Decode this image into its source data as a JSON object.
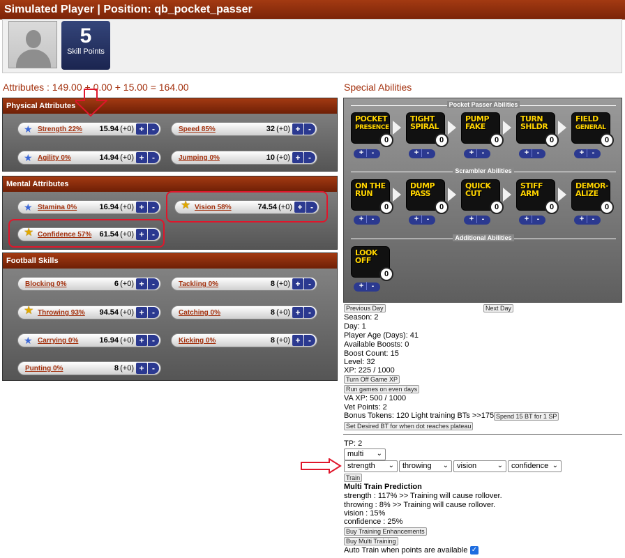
{
  "header": {
    "title": "Simulated Player | Position: qb_pocket_passer"
  },
  "profile": {
    "skill_points": "5",
    "skill_points_label": "Skill Points"
  },
  "attributes_total": "Attributes : 149.00 + 0.00 + 15.00 = 164.00",
  "special_abilities_title": "Special Abilities",
  "physical": {
    "title": "Physical Attributes",
    "strength": {
      "name": "Strength 22%",
      "value": "15.94",
      "bonus": "(+0)"
    },
    "speed": {
      "name": "Speed 85%",
      "value": "32",
      "bonus": "(+0)"
    },
    "agility": {
      "name": "Agility 0%",
      "value": "14.94",
      "bonus": "(+0)"
    },
    "jumping": {
      "name": "Jumping 0%",
      "value": "10",
      "bonus": "(+0)"
    }
  },
  "mental": {
    "title": "Mental Attributes",
    "stamina": {
      "name": "Stamina 0%",
      "value": "16.94",
      "bonus": "(+0)"
    },
    "vision": {
      "name": "Vision 58%",
      "value": "74.54",
      "bonus": "(+0)"
    },
    "confidence": {
      "name": "Confidence 57%",
      "value": "61.54",
      "bonus": "(+0)"
    }
  },
  "football": {
    "title": "Football Skills",
    "blocking": {
      "name": "Blocking 0%",
      "value": "6",
      "bonus": "(+0)"
    },
    "tackling": {
      "name": "Tackling 0%",
      "value": "8",
      "bonus": "(+0)"
    },
    "throwing": {
      "name": "Throwing 93%",
      "value": "94.54",
      "bonus": "(+0)"
    },
    "catching": {
      "name": "Catching 0%",
      "value": "8",
      "bonus": "(+0)"
    },
    "carrying": {
      "name": "Carrying 0%",
      "value": "16.94",
      "bonus": "(+0)"
    },
    "kicking": {
      "name": "Kicking 0%",
      "value": "8",
      "bonus": "(+0)"
    },
    "punting": {
      "name": "Punting 0%",
      "value": "8",
      "bonus": "(+0)"
    }
  },
  "buttons": {
    "plus": "+",
    "minus": "-"
  },
  "abilities": {
    "pocket_title": "Pocket Passer Abilities",
    "scrambler_title": "Scrambler Abilities",
    "additional_title": "Additional Abilities",
    "pocket": [
      {
        "l1": "POCKET",
        "l2": "PRESENCE",
        "level": "0"
      },
      {
        "l1": "TIGHT",
        "l2": "SPIRAL",
        "level": "0"
      },
      {
        "l1": "PUMP",
        "l2": "FAKE",
        "level": "0"
      },
      {
        "l1": "TURN",
        "l2": "SHLDR",
        "level": "0"
      },
      {
        "l1": "FIELD",
        "l2": "GENERAL",
        "level": "0"
      }
    ],
    "scrambler": [
      {
        "l1": "ON THE",
        "l2": "RUN",
        "level": "0"
      },
      {
        "l1": "DUMP",
        "l2": "PASS",
        "level": "0"
      },
      {
        "l1": "QUICK",
        "l2": "CUT",
        "level": "0"
      },
      {
        "l1": "STIFF",
        "l2": "ARM",
        "level": "0"
      },
      {
        "l1": "DEMOR-",
        "l2": "ALIZE",
        "level": "0"
      }
    ],
    "additional": [
      {
        "l1": "LOOK",
        "l2": "OFF",
        "level": "0"
      }
    ]
  },
  "info": {
    "prev_day": "Previous Day",
    "next_day": "Next Day",
    "season": "Season: 2",
    "day": "Day: 1",
    "age": "Player Age (Days): 41",
    "available_boosts": "Available Boosts: 0",
    "boost_count": "Boost Count: 15",
    "level": "Level: 32",
    "xp": "XP: 225 / 1000",
    "turn_off_game_xp": "Turn Off Game XP",
    "run_games": "Run games on even days",
    "va_xp": "VA XP: 500 / 1000",
    "vet_points": "Vet Points: 2",
    "bonus_tokens": "Bonus Tokens: 120 Light training BTs >>1758",
    "spend_bt": "Spend 15 BT for 1 SP",
    "set_desired_bt": "Set Desired BT for when dot reaches plateau"
  },
  "training": {
    "tp": "TP: 2",
    "mode": "multi",
    "selects": [
      "strength",
      "throwing",
      "vision",
      "confidence"
    ],
    "train_button": "Train",
    "prediction_title": "Multi Train Prediction",
    "predictions": [
      "strength : 117% >> Training will cause rollover.",
      "throwing : 8% >> Training will cause rollover.",
      "vision : 15%",
      "confidence : 25%"
    ],
    "buy_enhancements": "Buy Training Enhancements",
    "buy_multi": "Buy Multi Training",
    "auto_train": "Auto Train when points are available :",
    "auto_train_checked": true
  },
  "colors": {
    "brand": "#a3300d",
    "button_blue": "#2b3990",
    "annotation_red": "#e0162b",
    "ability_text": "#ffd400"
  },
  "icons": {
    "blue_star": "star-blue-icon",
    "gold_star": "star-gold-icon",
    "caret": "chevron-down-icon",
    "checkbox": "checkbox-checked-icon"
  }
}
